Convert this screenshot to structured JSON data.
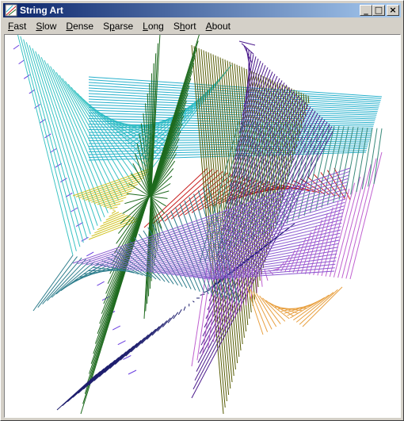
{
  "window": {
    "title": "String Art",
    "icon": "string-art-app-icon",
    "buttons": {
      "minimize": "_",
      "maximize": "□",
      "close": "×"
    }
  },
  "menu": [
    {
      "first": "F",
      "rest": "ast"
    },
    {
      "first": "S",
      "rest": "low"
    },
    {
      "first": "D",
      "rest": "ense"
    },
    {
      "first": "S",
      "pre": "",
      "rest": "parse",
      "label": "Sparse"
    },
    {
      "first": "L",
      "rest": "ong"
    },
    {
      "first": "S",
      "rest": "hort",
      "pre_under": "Sh",
      "label": "Short"
    },
    {
      "first": "A",
      "rest": "bout"
    }
  ],
  "colors": {
    "titlebar_start": "#0a246a",
    "titlebar_end": "#a6caf0",
    "canvas": "#ffffff"
  },
  "string_art": [
    {
      "color": "#6a3de0",
      "a": [
        [
          15,
          60
        ],
        [
          160,
          470
        ]
      ],
      "b": [
        [
          22,
          55
        ],
        [
          170,
          465
        ]
      ],
      "n": 22
    },
    {
      "color": "#39c3c3",
      "a": [
        [
          20,
          40
        ],
        [
          190,
          210
        ]
      ],
      "b": [
        [
          90,
          320
        ],
        [
          290,
          80
        ]
      ],
      "n": 45
    },
    {
      "color": "#26b0cc",
      "a": [
        [
          110,
          95
        ],
        [
          110,
          200
        ]
      ],
      "b": [
        [
          480,
          120
        ],
        [
          460,
          190
        ]
      ],
      "n": 30
    },
    {
      "color": "#d0c320",
      "a": [
        [
          110,
          300
        ],
        [
          190,
          210
        ]
      ],
      "b": [
        [
          175,
          275
        ],
        [
          90,
          245
        ]
      ],
      "n": 22
    },
    {
      "color": "#c81e1e",
      "a": [
        [
          180,
          285
        ],
        [
          420,
          210
        ]
      ],
      "b": [
        [
          260,
          210
        ],
        [
          440,
          250
        ]
      ],
      "n": 28
    },
    {
      "color": "#555a00",
      "a": [
        [
          240,
          55
        ],
        [
          390,
          120
        ]
      ],
      "b": [
        [
          280,
          520
        ],
        [
          390,
          120
        ]
      ],
      "n": 50
    },
    {
      "color": "#4b1a8c",
      "a": [
        [
          300,
          50
        ],
        [
          420,
          160
        ]
      ],
      "b": [
        [
          320,
          55
        ],
        [
          240,
          500
        ]
      ],
      "n": 40
    },
    {
      "color": "#1e6a1e",
      "a": [
        [
          100,
          520
        ],
        [
          200,
          40
        ]
      ],
      "b": [
        [
          250,
          40
        ],
        [
          180,
          400
        ]
      ],
      "n": 38
    },
    {
      "color": "#1e1e6e",
      "a": [
        [
          70,
          515
        ],
        [
          370,
          280
        ]
      ],
      "b": [
        [
          120,
          470
        ],
        [
          330,
          310
        ]
      ],
      "n": 45
    },
    {
      "color": "#c060d0",
      "a": [
        [
          260,
          330
        ],
        [
          440,
          350
        ]
      ],
      "b": [
        [
          240,
          460
        ],
        [
          480,
          190
        ]
      ],
      "n": 35
    },
    {
      "color": "#e8a040",
      "a": [
        [
          310,
          360
        ],
        [
          380,
          410
        ]
      ],
      "b": [
        [
          330,
          420
        ],
        [
          430,
          360
        ]
      ],
      "n": 18
    },
    {
      "color": "#2d7d8c",
      "a": [
        [
          40,
          390
        ],
        [
          260,
          230
        ]
      ],
      "b": [
        [
          90,
          320
        ],
        [
          300,
          380
        ]
      ],
      "n": 38
    },
    {
      "color": "#3a8a7a",
      "a": [
        [
          300,
          150
        ],
        [
          480,
          160
        ]
      ],
      "b": [
        [
          250,
          330
        ],
        [
          470,
          230
        ]
      ],
      "n": 30
    },
    {
      "color": "#8a5ad0",
      "a": [
        [
          90,
          330
        ],
        [
          260,
          350
        ]
      ],
      "b": [
        [
          440,
          210
        ],
        [
          420,
          340
        ]
      ],
      "n": 30
    }
  ]
}
